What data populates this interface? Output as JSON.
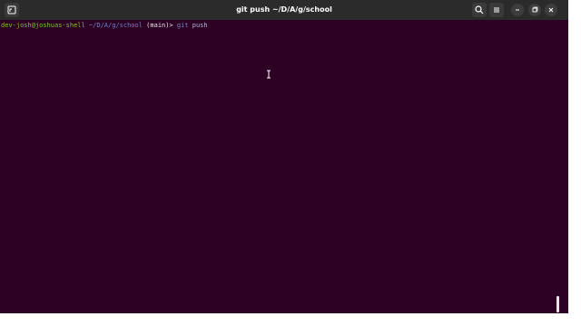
{
  "window": {
    "title": "git push ~/D/A/g/school"
  },
  "titlebar": {
    "new_tab_icon": "terminal-tab-icon",
    "search_icon": "search-icon",
    "menu_icon": "hamburger-menu-icon",
    "minimize_icon": "minimize-icon",
    "maximize_icon": "maximize-icon",
    "close_icon": "close-icon"
  },
  "terminal": {
    "user_host": "dev-josh@joshuas-shell",
    "path": "~/D/A/g/school",
    "branch": "(main)>",
    "command_part1": "git",
    "command_part2": "push"
  },
  "colors": {
    "background": "#2c0123",
    "titlebar": "#2b2b2b",
    "user_host": "#7ec72b",
    "path": "#6c84c8",
    "command": "#7d86c2"
  }
}
